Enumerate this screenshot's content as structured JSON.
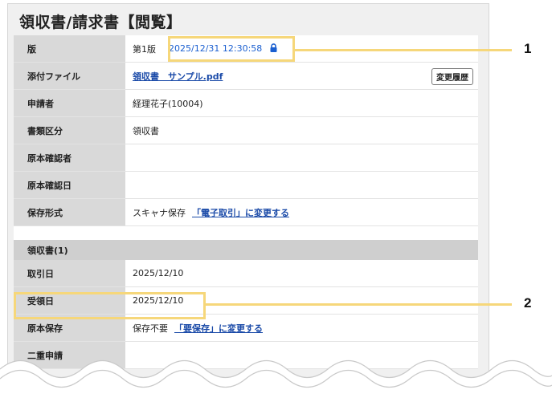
{
  "page": {
    "title": "領収書/請求書【閲覧】"
  },
  "rows": [
    {
      "label": "版",
      "version": "第1版",
      "date": "2025/12/31 12:30:58"
    },
    {
      "label": "添付ファイル",
      "file": "領収書　サンプル.pdf",
      "history_button": "変更履歴"
    },
    {
      "label": "申請者",
      "value": "経理花子(10004)"
    },
    {
      "label": "書類区分",
      "value": "領収書"
    },
    {
      "label": "原本確認者",
      "value": ""
    },
    {
      "label": "原本確認日",
      "value": ""
    },
    {
      "label": "保存形式",
      "value": "スキャナ保存",
      "link": "「電子取引」に変更する"
    }
  ],
  "section": {
    "title": "領収書(1)",
    "rows": [
      {
        "label": "取引日",
        "value": "2025/12/10"
      },
      {
        "label": "受領日",
        "value": "2025/12/10"
      },
      {
        "label": "原本保存",
        "value": "保存不要",
        "link": "「要保存」に変更する"
      },
      {
        "label": "二重申請",
        "value": ""
      }
    ]
  },
  "callouts": [
    "1",
    "2"
  ],
  "icons": {
    "lock": "lock-icon"
  },
  "colors": {
    "highlight": "#f6d77a",
    "link": "#1a4aa8",
    "label_bg": "#d9d9d9"
  }
}
